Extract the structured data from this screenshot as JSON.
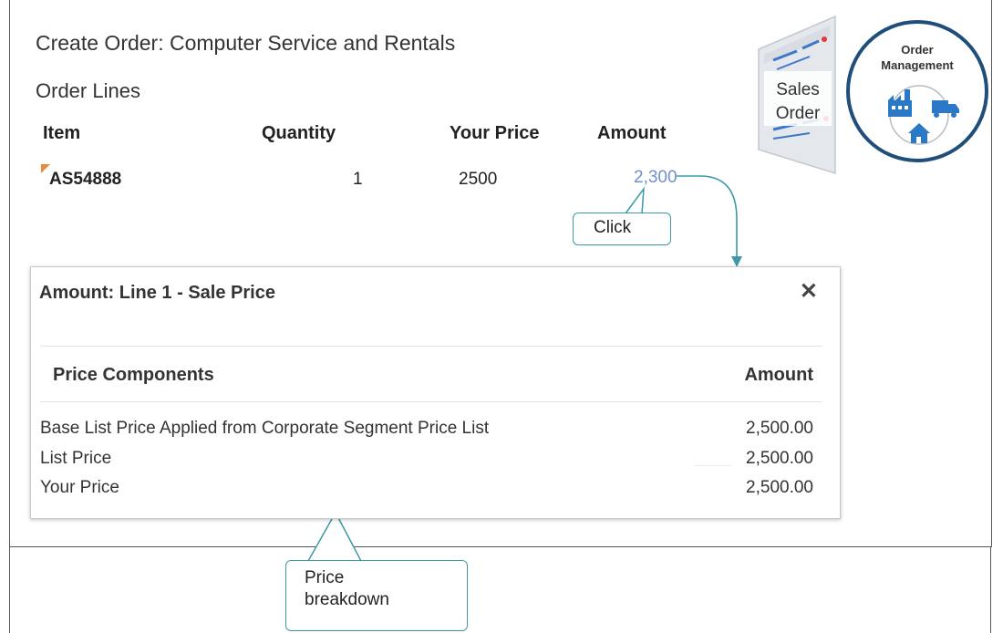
{
  "header": {
    "title": "Create Order: Computer Service and Rentals",
    "section": "Order Lines"
  },
  "order_lines": {
    "columns": [
      "Item",
      "Quantity",
      "Your Price",
      "Amount"
    ],
    "rows": [
      {
        "item": "AS54888",
        "quantity": "1",
        "your_price": "2500",
        "amount": "2,300"
      }
    ]
  },
  "callouts": {
    "click": "Click",
    "price_line1": "Price",
    "price_line2": "breakdown"
  },
  "popup": {
    "title": "Amount: Line 1 - Sale Price",
    "close_glyph": "✕",
    "col_components": "Price Components",
    "col_amount": "Amount",
    "rows": [
      {
        "label": "Base List Price Applied from Corporate  Segment Price List",
        "amount": "2,500.00"
      },
      {
        "label": "List Price",
        "amount": "2,500.00"
      },
      {
        "label": "Your Price",
        "amount": "2,500.00"
      }
    ]
  },
  "graphics": {
    "sales_order_line1": "Sales",
    "sales_order_line2": "Order",
    "om_line1": "Order",
    "om_line2": "Management",
    "icons": [
      "sales-order-document-icon",
      "factory-icon",
      "truck-icon",
      "house-icon"
    ]
  },
  "colors": {
    "link": "#6f8fcf",
    "callout_border": "#3b9aa6",
    "om_ring": "#1f4e7b",
    "icon_blue": "#2a78c6"
  }
}
